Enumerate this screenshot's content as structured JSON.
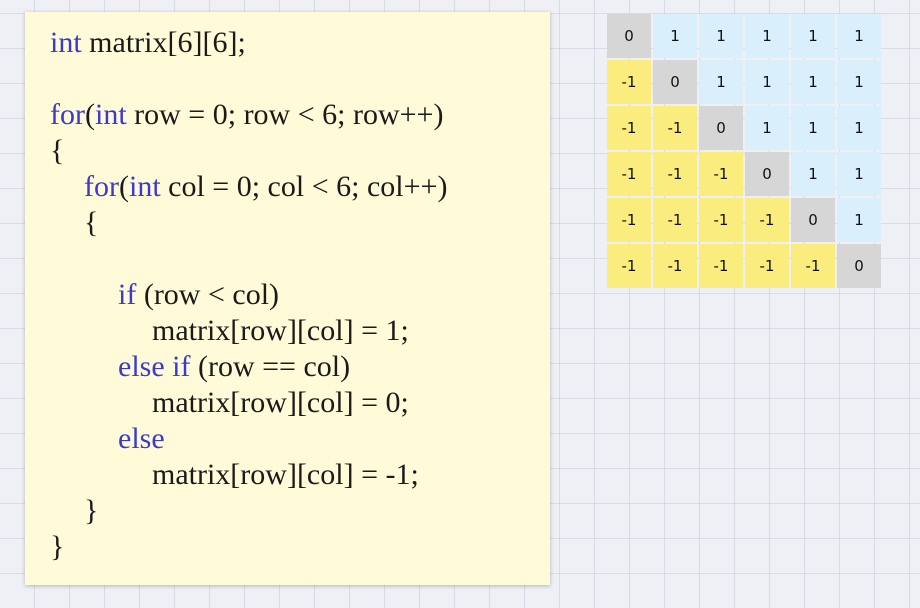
{
  "code": {
    "lines": [
      {
        "indent": 0,
        "tokens": [
          {
            "t": "int",
            "kw": true
          },
          {
            "t": " matrix[6][6];"
          }
        ]
      },
      {
        "indent": 0,
        "tokens": []
      },
      {
        "indent": 0,
        "tokens": [
          {
            "t": "for",
            "kw": true
          },
          {
            "t": "("
          },
          {
            "t": "int",
            "kw": true
          },
          {
            "t": " row = 0; row < 6; row++)"
          }
        ]
      },
      {
        "indent": 0,
        "tokens": [
          {
            "t": "{"
          }
        ]
      },
      {
        "indent": 1,
        "tokens": [
          {
            "t": "for",
            "kw": true
          },
          {
            "t": "("
          },
          {
            "t": "int",
            "kw": true
          },
          {
            "t": " col = 0; col < 6; col++)"
          }
        ]
      },
      {
        "indent": 1,
        "tokens": [
          {
            "t": "{"
          }
        ]
      },
      {
        "indent": 0,
        "tokens": []
      },
      {
        "indent": 2,
        "tokens": [
          {
            "t": "if",
            "kw": true
          },
          {
            "t": " (row < col)"
          }
        ]
      },
      {
        "indent": 3,
        "tokens": [
          {
            "t": "matrix[row][col] = 1;"
          }
        ]
      },
      {
        "indent": 2,
        "tokens": [
          {
            "t": "else if",
            "kw": true
          },
          {
            "t": " (row == col)"
          }
        ]
      },
      {
        "indent": 3,
        "tokens": [
          {
            "t": "matrix[row][col] = 0;"
          }
        ]
      },
      {
        "indent": 2,
        "tokens": [
          {
            "t": "else",
            "kw": true
          }
        ]
      },
      {
        "indent": 3,
        "tokens": [
          {
            "t": "matrix[row][col] = -1;"
          }
        ]
      },
      {
        "indent": 1,
        "tokens": [
          {
            "t": "}"
          }
        ]
      },
      {
        "indent": 0,
        "tokens": [
          {
            "t": "}"
          }
        ]
      }
    ],
    "keyword_color": "#3a3ad0",
    "text_color": "#1a1a1a",
    "background": "#fffbd9"
  },
  "matrix": {
    "rows": [
      [
        "0",
        "1",
        "1",
        "1",
        "1",
        "1"
      ],
      [
        "-1",
        "0",
        "1",
        "1",
        "1",
        "1"
      ],
      [
        "-1",
        "-1",
        "0",
        "1",
        "1",
        "1"
      ],
      [
        "-1",
        "-1",
        "-1",
        "0",
        "1",
        "1"
      ],
      [
        "-1",
        "-1",
        "-1",
        "-1",
        "0",
        "1"
      ],
      [
        "-1",
        "-1",
        "-1",
        "-1",
        "-1",
        "0"
      ]
    ],
    "colors": {
      "upper": "#d9effc",
      "diagonal": "#d6d6d6",
      "lower": "#fbec7e"
    }
  }
}
